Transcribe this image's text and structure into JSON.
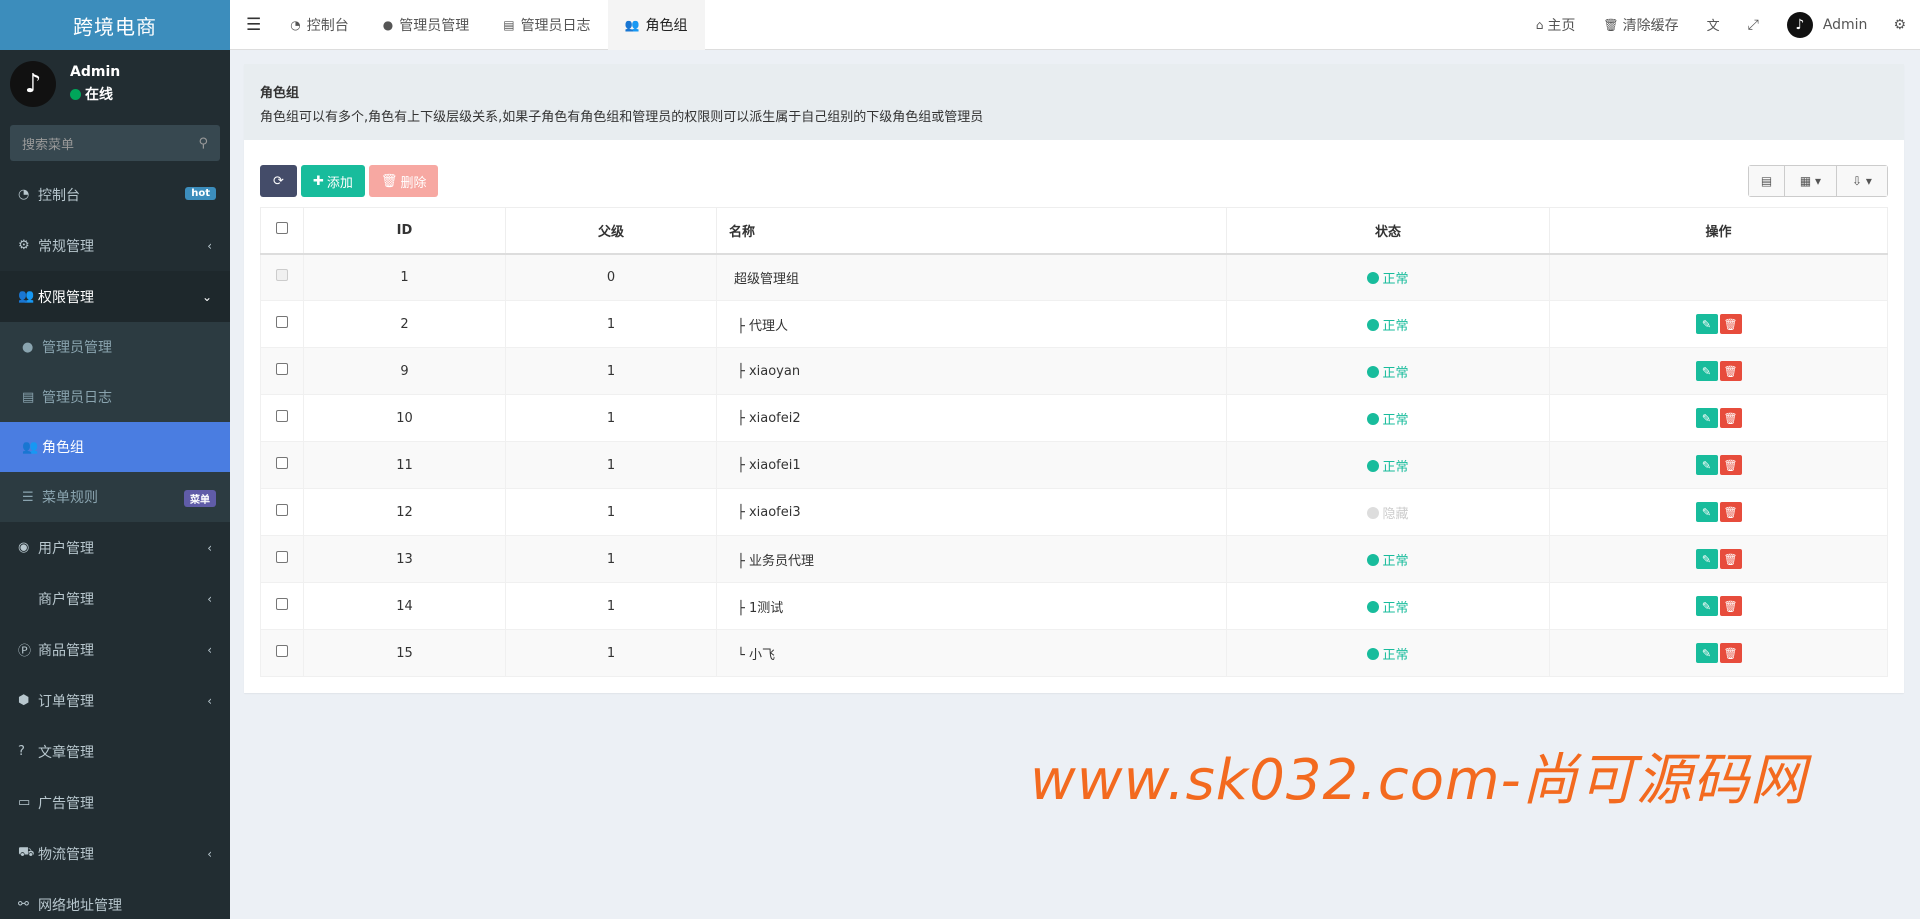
{
  "app": {
    "title": "跨境电商"
  },
  "user": {
    "name": "Admin",
    "status": "在线",
    "avatar_icon": "tiktok-logo-icon"
  },
  "search": {
    "placeholder": "搜索菜单"
  },
  "sidebar": {
    "items": [
      {
        "icon": "dashboard-icon",
        "label": "控制台",
        "badge": "hot"
      },
      {
        "icon": "cogs-icon",
        "label": "常规管理"
      },
      {
        "icon": "users-icon",
        "label": "权限管理"
      },
      {
        "icon": "user-icon",
        "label": "管理员管理"
      },
      {
        "icon": "list-alt-icon",
        "label": "管理员日志"
      },
      {
        "icon": "group-icon",
        "label": "角色组"
      },
      {
        "icon": "bars-icon",
        "label": "菜单规则",
        "badge": "菜单"
      },
      {
        "icon": "user-circle-icon",
        "label": "用户管理"
      },
      {
        "icon": "apple-icon",
        "label": "商户管理"
      },
      {
        "icon": "product-icon",
        "label": "商品管理"
      },
      {
        "icon": "cube-icon",
        "label": "订单管理"
      },
      {
        "icon": "question-icon",
        "label": "文章管理"
      },
      {
        "icon": "ad-icon",
        "label": "广告管理"
      },
      {
        "icon": "truck-icon",
        "label": "物流管理"
      },
      {
        "icon": "link-icon",
        "label": "网络地址管理"
      }
    ]
  },
  "topbar": {
    "tabs": [
      {
        "icon": "dashboard-icon",
        "label": "控制台"
      },
      {
        "icon": "user-icon",
        "label": "管理员管理"
      },
      {
        "icon": "list-alt-icon",
        "label": "管理员日志"
      },
      {
        "icon": "users-icon",
        "label": "角色组"
      }
    ],
    "right": {
      "home": "主页",
      "clear_cache": "清除缓存",
      "admin": "Admin"
    }
  },
  "panel": {
    "title": "角色组",
    "desc": "角色组可以有多个,角色有上下级层级关系,如果子角色有角色组和管理员的权限则可以派生属于自己组别的下级角色组或管理员"
  },
  "toolbar": {
    "add": "添加",
    "delete": "删除"
  },
  "table": {
    "headers": {
      "id": "ID",
      "parent": "父级",
      "name": "名称",
      "status": "状态",
      "ops": "操作"
    },
    "rows": [
      {
        "id": "1",
        "pid": "0",
        "name": "超级管理组",
        "status": "正常"
      },
      {
        "id": "2",
        "pid": "1",
        "name": "├ 代理人",
        "status": "正常"
      },
      {
        "id": "9",
        "pid": "1",
        "name": "├ xiaoyan",
        "status": "正常"
      },
      {
        "id": "10",
        "pid": "1",
        "name": "├ xiaofei2",
        "status": "正常"
      },
      {
        "id": "11",
        "pid": "1",
        "name": "├ xiaofei1",
        "status": "正常"
      },
      {
        "id": "12",
        "pid": "1",
        "name": "├ xiaofei3",
        "status": "隐藏"
      },
      {
        "id": "13",
        "pid": "1",
        "name": "├ 业务员代理",
        "status": "正常"
      },
      {
        "id": "14",
        "pid": "1",
        "name": "├ 1测试",
        "status": "正常"
      },
      {
        "id": "15",
        "pid": "1",
        "name": "└ 小飞",
        "status": "正常"
      }
    ]
  },
  "watermark": "www.sk032.com-尚可源码网",
  "colors": {
    "accent": "#4a7de1",
    "success": "#18bc9c",
    "danger": "#e74c3c",
    "sidebar": "#222d32",
    "logo_bg": "#3c8dbc",
    "watermark": "#f36a1f"
  }
}
